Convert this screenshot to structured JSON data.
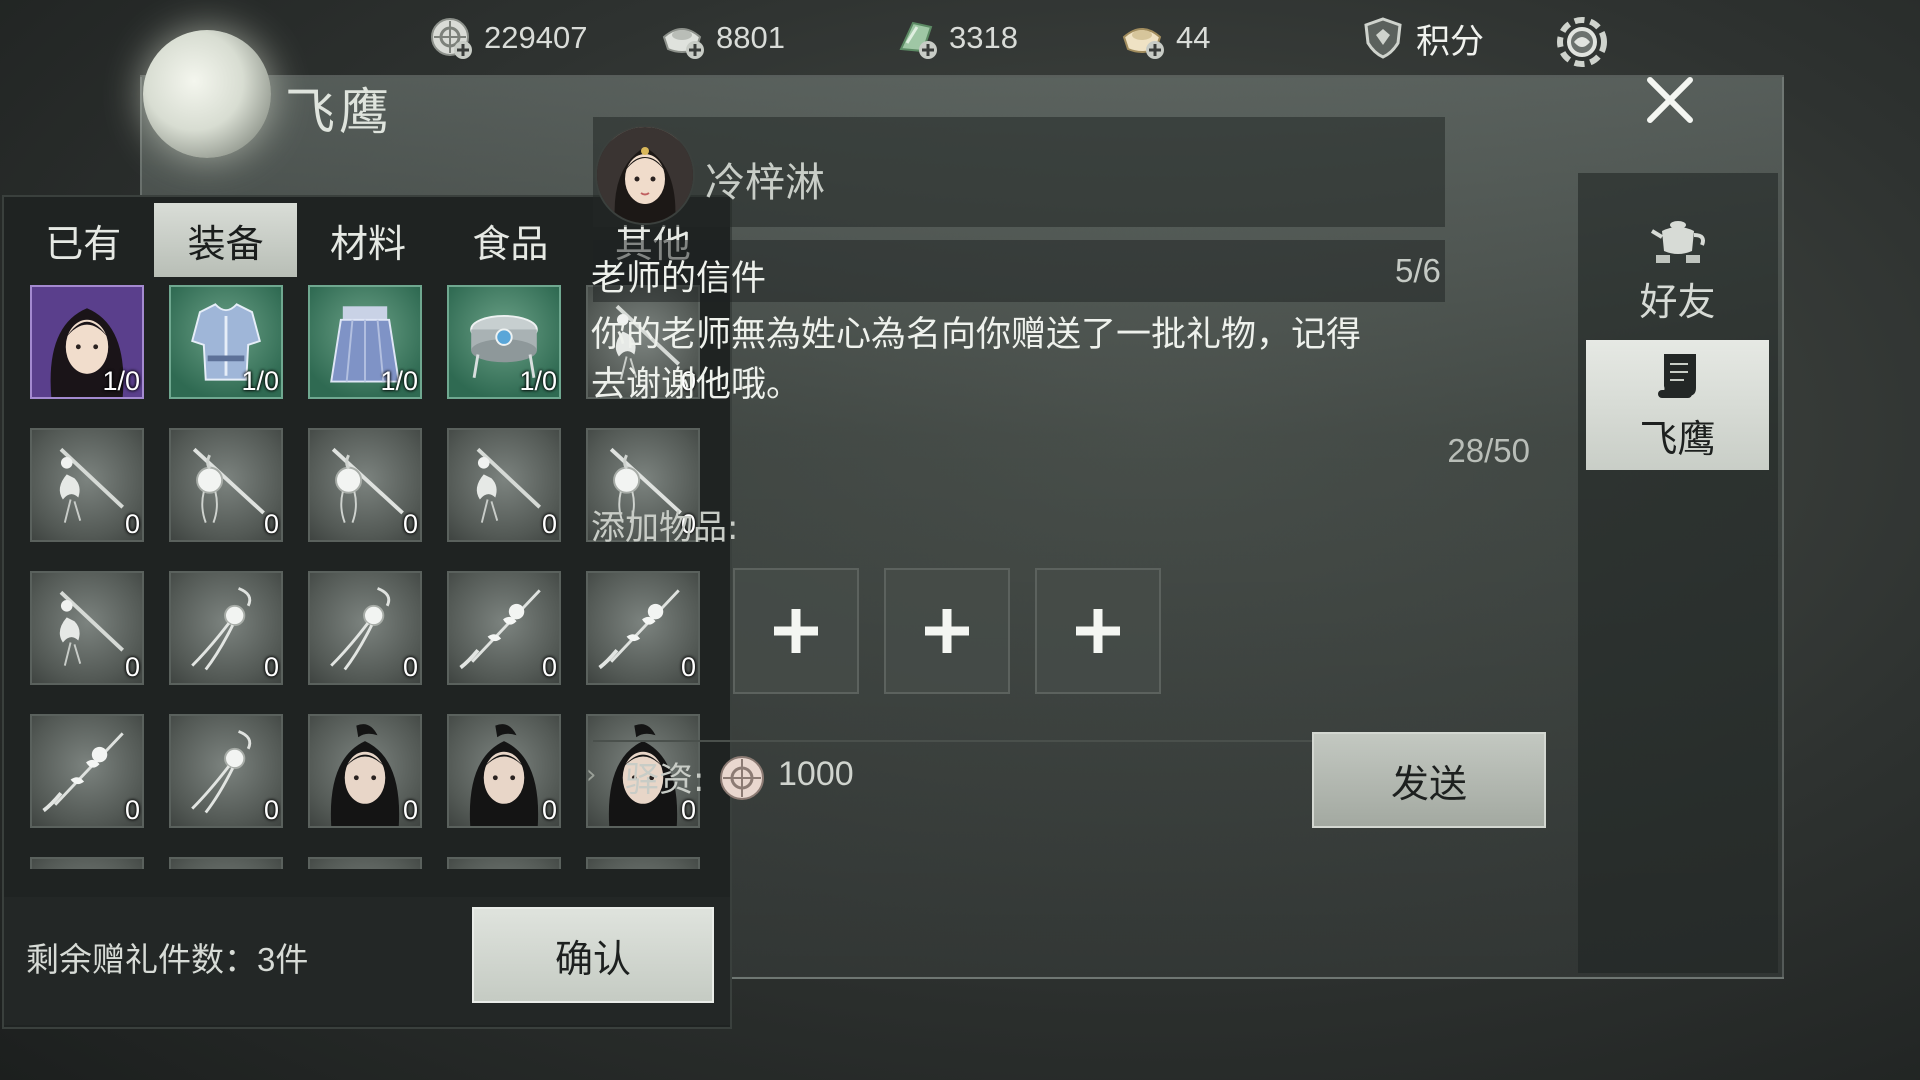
{
  "currencies": [
    {
      "icon": "coin-plus-icon",
      "value": "229407"
    },
    {
      "icon": "silver-ingot-plus-icon",
      "value": "8801"
    },
    {
      "icon": "jade-plus-icon",
      "value": "3318"
    },
    {
      "icon": "gold-ingot-plus-icon",
      "value": "44"
    }
  ],
  "points": {
    "icon": "shield-points-icon",
    "label": "积分"
  },
  "settings_icon": "gear-icon",
  "window": {
    "title": "飞鹰",
    "close_icon": "close-icon"
  },
  "tabs": [
    {
      "label": "已有",
      "active": false
    },
    {
      "label": "装备",
      "active": true
    },
    {
      "label": "材料",
      "active": false
    },
    {
      "label": "食品",
      "active": false
    },
    {
      "label": "其他",
      "active": false
    }
  ],
  "items": [
    {
      "kind": "portrait-female",
      "quality": "purple",
      "count": "1/0"
    },
    {
      "kind": "armor-top",
      "quality": "green",
      "count": "1/0"
    },
    {
      "kind": "armor-skirt",
      "quality": "green",
      "count": "1/0"
    },
    {
      "kind": "bracer",
      "quality": "green",
      "count": "1/0"
    },
    {
      "kind": "lotus-pendant",
      "quality": "gray",
      "count": "0"
    },
    {
      "kind": "lotus-pendant",
      "quality": "gray",
      "count": "0"
    },
    {
      "kind": "orb-pendant",
      "quality": "gray",
      "count": "0"
    },
    {
      "kind": "orb-pendant",
      "quality": "gray",
      "count": "0"
    },
    {
      "kind": "lotus-pendant",
      "quality": "gray",
      "count": "0"
    },
    {
      "kind": "orb-pendant",
      "quality": "gray",
      "count": "0"
    },
    {
      "kind": "lotus-pendant",
      "quality": "gray",
      "count": "0"
    },
    {
      "kind": "tassel",
      "quality": "gray",
      "count": "0"
    },
    {
      "kind": "tassel",
      "quality": "gray",
      "count": "0"
    },
    {
      "kind": "flower-tassel",
      "quality": "gray",
      "count": "0"
    },
    {
      "kind": "flower-tassel",
      "quality": "gray",
      "count": "0"
    },
    {
      "kind": "flower-tassel",
      "quality": "gray",
      "count": "0"
    },
    {
      "kind": "tassel",
      "quality": "gray",
      "count": "0"
    },
    {
      "kind": "portrait-male",
      "quality": "gray",
      "count": "0"
    },
    {
      "kind": "portrait-male",
      "quality": "gray",
      "count": "0"
    },
    {
      "kind": "portrait-male",
      "quality": "gray",
      "count": "0"
    },
    {
      "kind": "blank",
      "quality": "gray",
      "count": ""
    },
    {
      "kind": "blank",
      "quality": "gray",
      "count": ""
    },
    {
      "kind": "blank",
      "quality": "gray",
      "count": ""
    },
    {
      "kind": "blank",
      "quality": "gray",
      "count": ""
    },
    {
      "kind": "blank",
      "quality": "gray",
      "count": ""
    }
  ],
  "inventory_footer": {
    "remaining_label": "剩余赠礼件数：",
    "remaining_count": "3件",
    "confirm_label": "确认"
  },
  "recipient": {
    "name": "冷梓淋",
    "avatar_icon": "recipient-avatar"
  },
  "letter": {
    "title": "老师的信件",
    "page": "5/6",
    "body": "你的老师無為姓心為名向你赠送了一批礼物，记得\n去谢谢他哦。",
    "char_count": "28/50"
  },
  "attachments": {
    "label": "添加物品:",
    "slots": [
      "plus-icon",
      "plus-icon",
      "plus-icon"
    ]
  },
  "postage": {
    "arrow": "›",
    "label": "驿资:",
    "icon": "coin-icon",
    "value": "1000"
  },
  "send_label": "发送",
  "side_tabs": [
    {
      "label": "好友",
      "icon": "teapot-icon",
      "active": false
    },
    {
      "label": "飞鹰",
      "icon": "scroll-icon",
      "active": true
    }
  ],
  "colors": {
    "accent_purple": "#8a6bc0",
    "accent_green": "#2f6a52",
    "panel": "#1f2322"
  }
}
